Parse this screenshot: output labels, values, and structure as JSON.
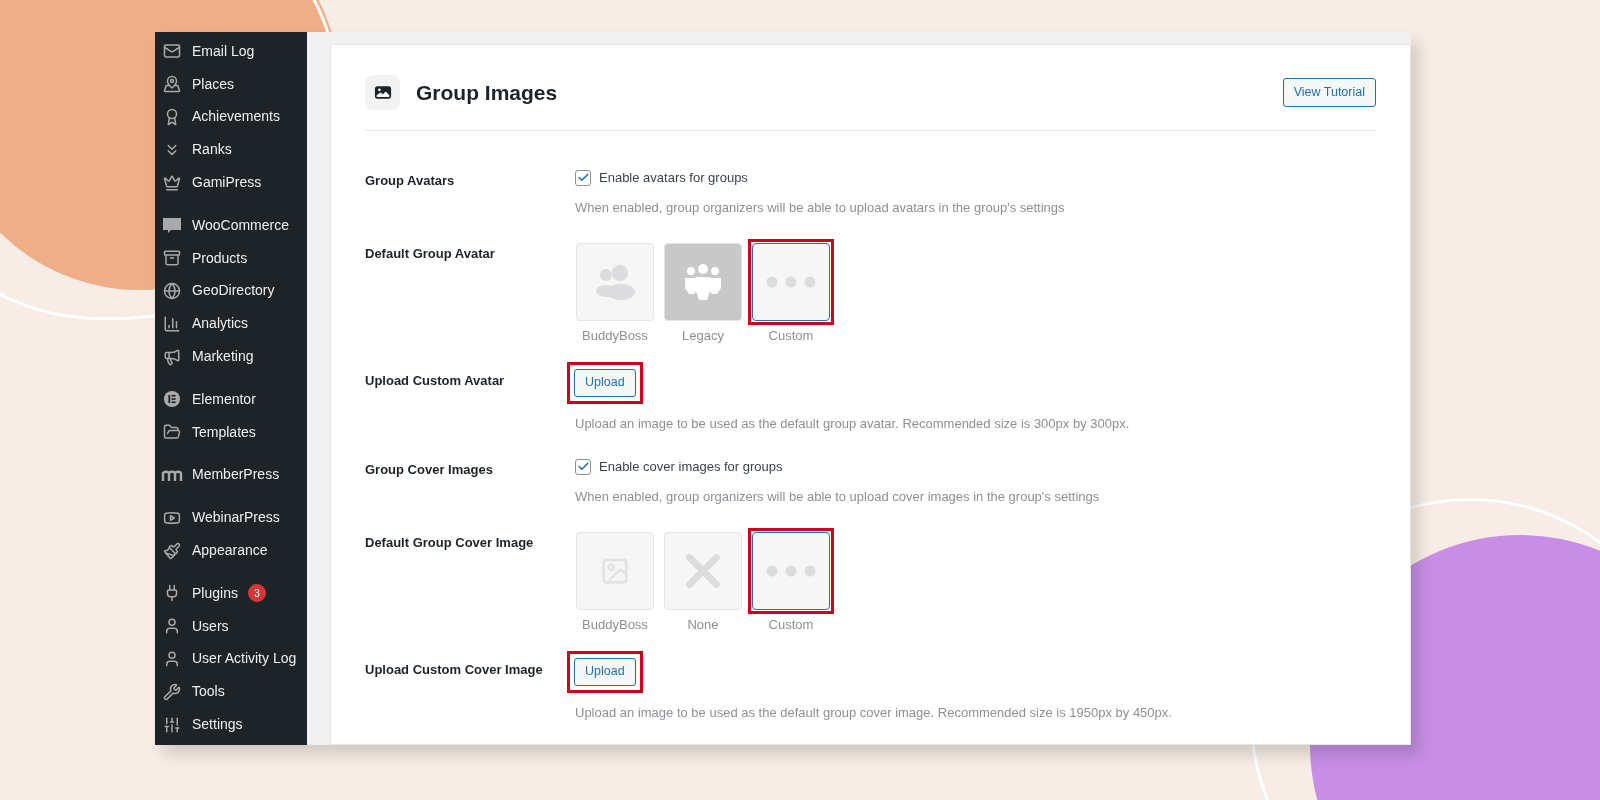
{
  "sidebar": {
    "groups": [
      {
        "items": [
          {
            "label": "Email Log"
          },
          {
            "label": "Places"
          },
          {
            "label": "Achievements"
          },
          {
            "label": "Ranks"
          },
          {
            "label": "GamiPress"
          }
        ]
      },
      {
        "items": [
          {
            "label": "WooCommerce"
          },
          {
            "label": "Products"
          },
          {
            "label": "GeoDirectory"
          },
          {
            "label": "Analytics"
          },
          {
            "label": "Marketing"
          }
        ]
      },
      {
        "items": [
          {
            "label": "Elementor"
          },
          {
            "label": "Templates"
          }
        ]
      },
      {
        "items": [
          {
            "label": "MemberPress"
          }
        ]
      },
      {
        "items": [
          {
            "label": "WebinarPress"
          },
          {
            "label": "Appearance"
          }
        ]
      },
      {
        "items": [
          {
            "label": "Plugins",
            "badge": "3"
          },
          {
            "label": "Users"
          },
          {
            "label": "User Activity Log"
          },
          {
            "label": "Tools"
          },
          {
            "label": "Settings"
          }
        ]
      }
    ]
  },
  "header": {
    "title": "Group Images",
    "tutorial_button": "View Tutorial"
  },
  "settings": [
    {
      "kind": "checkbox",
      "label": "Group Avatars",
      "option": "Enable avatars for groups",
      "checked": true,
      "help": "When enabled, group organizers will be able to upload avatars in the group's settings"
    },
    {
      "kind": "choices",
      "label": "Default Group Avatar",
      "choices": [
        {
          "kind": "people",
          "caption": "BuddyBoss",
          "selected": false,
          "highlighted": false
        },
        {
          "kind": "legacy",
          "caption": "Legacy",
          "selected": false,
          "highlighted": false
        },
        {
          "kind": "dots",
          "caption": "Custom",
          "selected": true,
          "highlighted": true
        }
      ]
    },
    {
      "kind": "upload",
      "label": "Upload Custom Avatar",
      "button": "Upload",
      "highlighted": true,
      "help": "Upload an image to be used as the default group avatar. Recommended size is 300px by 300px."
    },
    {
      "kind": "checkbox",
      "label": "Group Cover Images",
      "option": "Enable cover images for groups",
      "checked": true,
      "help": "When enabled, group organizers will be able to upload cover images in the group's settings"
    },
    {
      "kind": "choices",
      "label": "Default Group Cover Image",
      "choices": [
        {
          "kind": "pattern",
          "caption": "BuddyBoss",
          "selected": false,
          "highlighted": false
        },
        {
          "kind": "none",
          "caption": "None",
          "selected": false,
          "highlighted": false
        },
        {
          "kind": "dots",
          "caption": "Custom",
          "selected": true,
          "highlighted": true
        }
      ]
    },
    {
      "kind": "upload",
      "label": "Upload Custom Cover Image",
      "button": "Upload",
      "highlighted": true,
      "help": "Upload an image to be used as the default group cover image. Recommended size is 1950px by 450px."
    }
  ]
}
